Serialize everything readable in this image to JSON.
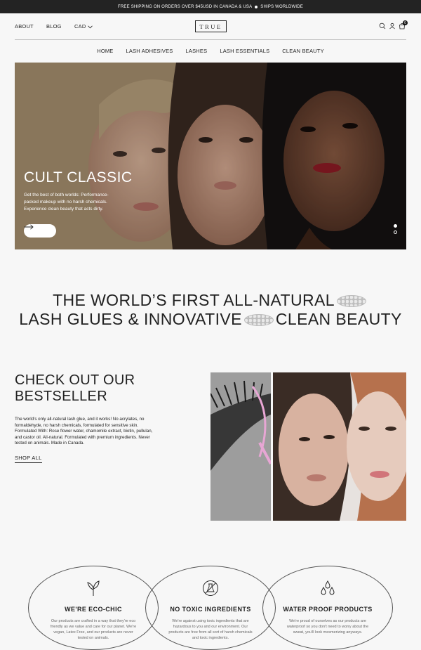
{
  "announcement": {
    "left": "FREE SHIPPING ON ORDERS OVER $45USD IN CANADA & USA",
    "right": "SHIPS WORLDWIDE"
  },
  "header": {
    "links": [
      "ABOUT",
      "BLOG"
    ],
    "currency": "CAD",
    "logo": "TRUE",
    "cart_count": "0",
    "icons": [
      "search-icon",
      "account-icon",
      "cart-icon"
    ]
  },
  "nav": [
    "HOME",
    "LASH ADHESIVES",
    "LASHES",
    "LASH ESSENTIALS",
    "CLEAN BEAUTY"
  ],
  "hero": {
    "title": "CULT CLASSIC",
    "text": "Get the best of both worlds: Performance-packed makeup with no harsh chemicals. Experience clean beauty that acts dirty.",
    "button_icon": "arrow-right-icon",
    "slides": 2,
    "active_slide": 1
  },
  "tagline": {
    "line1": "THE WORLD’S FIRST ALL-NATURAL",
    "line2a": "LASH GLUES & INNOVATIVE",
    "line2b": "CLEAN BEAUTY"
  },
  "bestseller": {
    "title_line1": "CHECK OUT OUR",
    "title_line2": "BESTSELLER",
    "text": "The world's only all-natural lash glue, and it works! No acrylates, no formaldehyde, no harsh chemicals, formulated for sensitive skin. Formulated With: Rose flower water, chamomile extract, biotin, pullulan, and castor oil. All-natural. Formulated with premium ingredients. Never tested on animals. Made in Canada.",
    "link": "SHOP ALL"
  },
  "features": [
    {
      "icon": "leaf-sprout-icon",
      "title": "WE'RE ECO-CHIC",
      "text": "Our products are crafted in a way that they're eco friendly as we value and care for our planet. We're vegan, Latex Free, and our products are never tested on animals."
    },
    {
      "icon": "no-chemicals-icon",
      "title": "NO TOXIC INGREDIENTS",
      "text": "We're against using toxic ingredients that are hazardous to you and our environment. Our products are free from all sort of harsh chemicals and toxic ingredients."
    },
    {
      "icon": "water-drops-icon",
      "title": "WATER PROOF PRODUCTS",
      "text": "We're proud of ourselves as our products are waterproof so you don't need to worry about the sweat, you'll look mesmerizing anyways."
    }
  ]
}
